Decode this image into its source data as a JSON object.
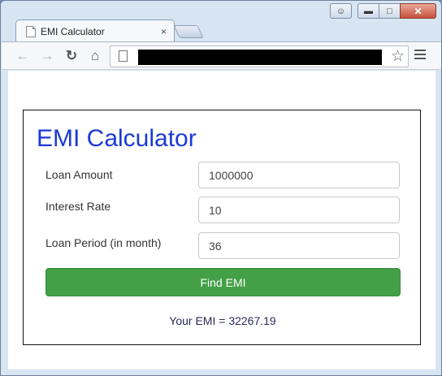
{
  "browser": {
    "tab_title": "EMI Calculator",
    "tab_close": "×",
    "url": ""
  },
  "page": {
    "heading": "EMI Calculator",
    "fields": [
      {
        "label": "Loan Amount",
        "value": "1000000"
      },
      {
        "label": "Interest Rate",
        "value": "10"
      },
      {
        "label": "Loan Period (in month)",
        "value": "36"
      }
    ],
    "button_label": "Find EMI",
    "result_prefix": "Your EMI = ",
    "result_value": "32267.19"
  },
  "colors": {
    "heading": "#1a3ad6",
    "button": "#43a047"
  },
  "icons": [
    "profile-icon",
    "minimize-icon",
    "maximize-icon",
    "close-icon",
    "page-icon",
    "back-icon",
    "forward-icon",
    "reload-icon",
    "home-icon",
    "bookmark-star-icon",
    "menu-icon"
  ]
}
